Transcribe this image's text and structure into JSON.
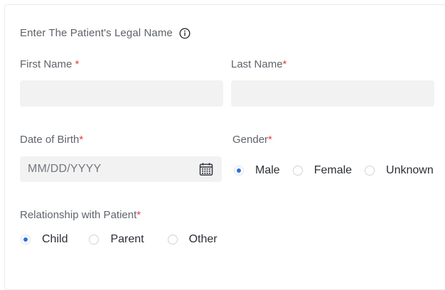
{
  "form": {
    "section_title": "Enter The Patient's Legal Name",
    "first_name_label": "First Name",
    "last_name_label": "Last Name",
    "required_marker": "*",
    "first_name_value": "",
    "last_name_value": "",
    "dob_label": "Date of Birth",
    "dob_placeholder": "MM/DD/YYYY",
    "gender_label": "Gender",
    "gender_options": [
      "Male",
      "Female",
      "Unknown"
    ],
    "gender_selected": "Male",
    "relationship_label": "Relationship with Patient",
    "relationship_options": [
      "Child",
      "Parent",
      "Other"
    ],
    "relationship_selected": "Child"
  },
  "colors": {
    "required": "#e0443b",
    "radio_selected": "#2f6fd6",
    "input_bg": "#f2f2f2"
  },
  "icons": {
    "info": "info-circle-icon",
    "date": "calendar-icon"
  }
}
